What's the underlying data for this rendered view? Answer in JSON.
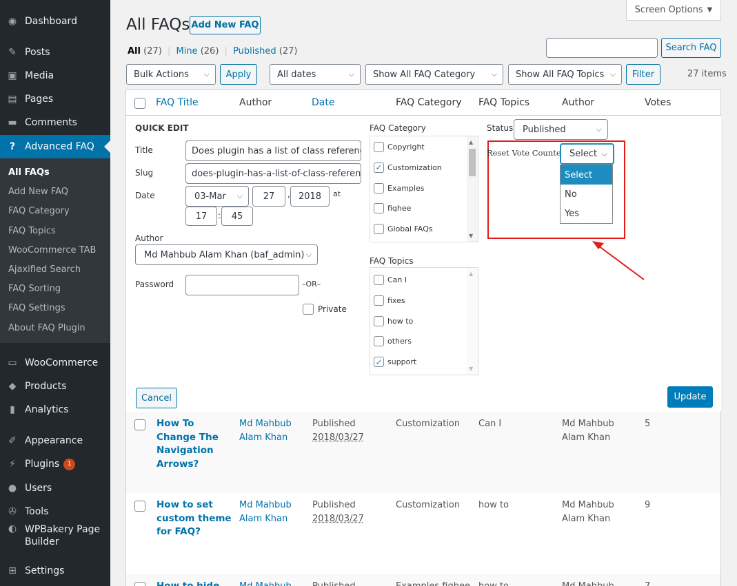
{
  "sidebar": {
    "items": [
      {
        "label": "Dashboard",
        "icon": "dashboard-icon"
      },
      {
        "label": "Posts",
        "icon": "pin-icon"
      },
      {
        "label": "Media",
        "icon": "media-icon"
      },
      {
        "label": "Pages",
        "icon": "pages-icon"
      },
      {
        "label": "Comments",
        "icon": "comment-icon"
      },
      {
        "label": "Advanced FAQ",
        "icon": "help-icon"
      },
      {
        "label": "WooCommerce",
        "icon": "woocommerce-icon"
      },
      {
        "label": "Products",
        "icon": "products-icon"
      },
      {
        "label": "Analytics",
        "icon": "chart-icon"
      },
      {
        "label": "Appearance",
        "icon": "brush-icon"
      },
      {
        "label": "Plugins",
        "icon": "plugin-icon",
        "badge": "1"
      },
      {
        "label": "Users",
        "icon": "user-icon"
      },
      {
        "label": "Tools",
        "icon": "wrench-icon"
      },
      {
        "label": "WPBakery Page Builder",
        "icon": "wpbakery-icon"
      },
      {
        "label": "Settings",
        "icon": "settings-icon"
      }
    ],
    "submenu": [
      "All FAQs",
      "Add New FAQ",
      "FAQ Category",
      "FAQ Topics",
      "WooCommerce TAB",
      "Ajaxified Search",
      "FAQ Sorting",
      "FAQ Settings",
      "About FAQ Plugin"
    ]
  },
  "header": {
    "screen_options": "Screen Options",
    "title": "All FAQs",
    "add_new": "Add New FAQ",
    "search_button": "Search FAQ",
    "search_value": ""
  },
  "views": {
    "all_label": "All",
    "all_count": "(27)",
    "mine_label": "Mine",
    "mine_count": "(26)",
    "published_label": "Published",
    "published_count": "(27)"
  },
  "filters": {
    "bulk_actions": "Bulk Actions",
    "apply": "Apply",
    "dates": "All dates",
    "category": "Show All FAQ Category",
    "topics": "Show All FAQ Topics",
    "filter": "Filter",
    "items_count": "27 items"
  },
  "table": {
    "columns": [
      "FAQ Title",
      "Author",
      "Date",
      "FAQ Category",
      "FAQ Topics",
      "Author",
      "Votes"
    ],
    "rows": [
      {
        "title": "How To Change The Navigation Arrows?",
        "author": "Md Mahbub Alam Khan",
        "status": "Published",
        "date": "2018/03/27",
        "category": "Customization",
        "topics": "Can I",
        "author2": "Md Mahbub Alam Khan",
        "votes": "5"
      },
      {
        "title": "How to set custom theme for FAQ?",
        "author": "Md Mahbub Alam Khan",
        "status": "Published",
        "date": "2018/03/27",
        "category": "Customization",
        "topics": "how to",
        "author2": "Md Mahbub Alam Khan",
        "votes": "9"
      },
      {
        "title": "How to hide",
        "author": "Md Mahbub",
        "status": "Published",
        "date": "",
        "category": "Examples fiqhee",
        "topics": "how to",
        "author2": "Md Mahbub",
        "votes": "7"
      }
    ]
  },
  "quick_edit": {
    "heading": "QUICK EDIT",
    "title_label": "Title",
    "title_value": "Does plugin has a list of class reference",
    "slug_label": "Slug",
    "slug_value": "does-plugin-has-a-list-of-class-referen",
    "date_label": "Date",
    "month": "03-Mar",
    "day": "27",
    "year": "2018",
    "at": "at",
    "hour": "17",
    "colon": ":",
    "minute": "45",
    "author_label": "Author",
    "author_value": "Md Mahbub Alam Khan (baf_admin)",
    "password_label": "Password",
    "password_value": "",
    "or_label": "–OR–",
    "private_label": "Private",
    "category_label": "FAQ Category",
    "categories": [
      {
        "label": "Copyright",
        "checked": false
      },
      {
        "label": "Customization",
        "checked": true
      },
      {
        "label": "Examples",
        "checked": false
      },
      {
        "label": "fiqhee",
        "checked": false
      },
      {
        "label": "Global FAQs",
        "checked": false
      }
    ],
    "topics_label": "FAQ Topics",
    "topics": [
      {
        "label": "Can I",
        "checked": false
      },
      {
        "label": "fixes",
        "checked": false
      },
      {
        "label": "how to",
        "checked": false
      },
      {
        "label": "others",
        "checked": false
      },
      {
        "label": "support",
        "checked": true
      }
    ],
    "status_label": "Status",
    "status_value": "Published",
    "reset_label": "Reset Vote Counter",
    "reset_value": "Select",
    "reset_options": [
      "Select",
      "No",
      "Yes"
    ],
    "cancel": "Cancel",
    "update": "Update"
  },
  "colors": {
    "sidebar_bg": "#23282d",
    "accent": "#0073aa",
    "highlight": "#e21b1b",
    "badge": "#ca4a1f"
  }
}
